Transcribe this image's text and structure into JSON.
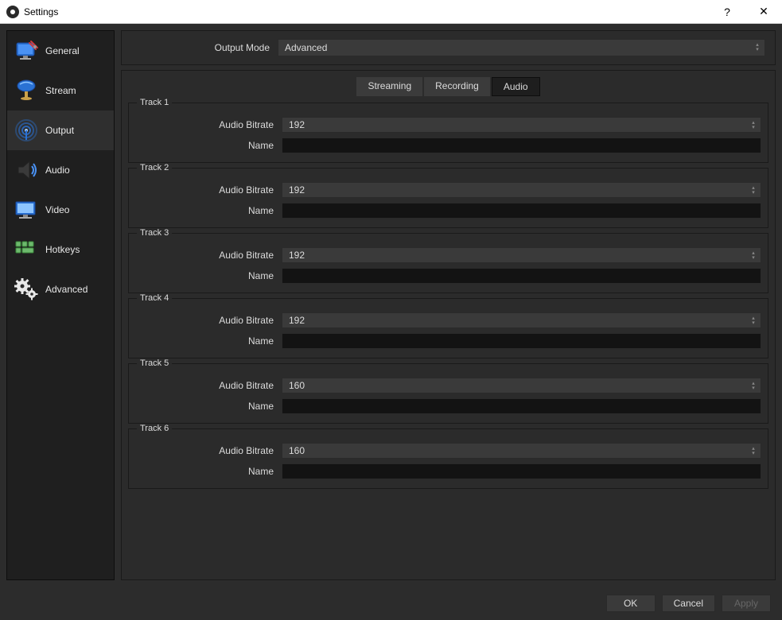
{
  "window": {
    "title": "Settings"
  },
  "sidebar": {
    "items": [
      {
        "label": "General"
      },
      {
        "label": "Stream"
      },
      {
        "label": "Output"
      },
      {
        "label": "Audio"
      },
      {
        "label": "Video"
      },
      {
        "label": "Hotkeys"
      },
      {
        "label": "Advanced"
      }
    ],
    "selected_index": 2
  },
  "mode": {
    "label": "Output Mode",
    "value": "Advanced"
  },
  "tabs": {
    "items": [
      {
        "label": "Streaming"
      },
      {
        "label": "Recording"
      },
      {
        "label": "Audio"
      }
    ],
    "active_index": 2
  },
  "labels": {
    "audio_bitrate": "Audio Bitrate",
    "name": "Name"
  },
  "tracks": [
    {
      "title": "Track 1",
      "bitrate": "192",
      "name": ""
    },
    {
      "title": "Track 2",
      "bitrate": "192",
      "name": ""
    },
    {
      "title": "Track 3",
      "bitrate": "192",
      "name": ""
    },
    {
      "title": "Track 4",
      "bitrate": "192",
      "name": ""
    },
    {
      "title": "Track 5",
      "bitrate": "160",
      "name": ""
    },
    {
      "title": "Track 6",
      "bitrate": "160",
      "name": ""
    }
  ],
  "footer": {
    "ok": "OK",
    "cancel": "Cancel",
    "apply": "Apply"
  }
}
